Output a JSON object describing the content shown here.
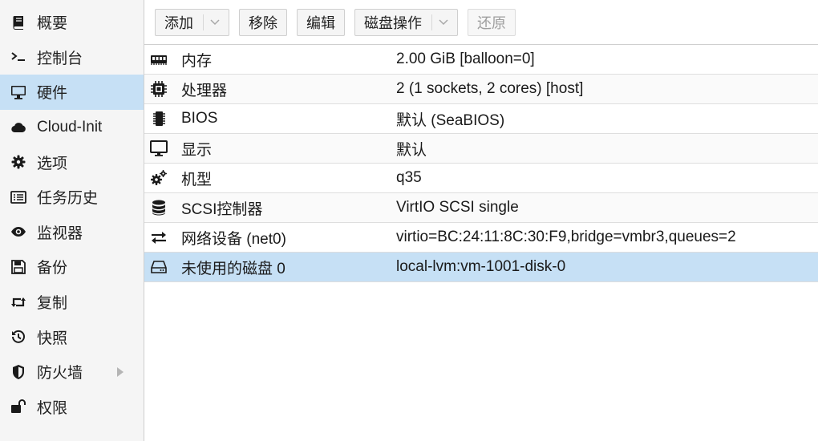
{
  "sidebar": {
    "items": [
      {
        "label": "概要",
        "icon": "book-icon"
      },
      {
        "label": "控制台",
        "icon": "terminal-icon"
      },
      {
        "label": "硬件",
        "icon": "monitor-icon"
      },
      {
        "label": "Cloud-Init",
        "icon": "cloud-icon"
      },
      {
        "label": "选项",
        "icon": "gear-icon"
      },
      {
        "label": "任务历史",
        "icon": "list-icon"
      },
      {
        "label": "监视器",
        "icon": "eye-icon"
      },
      {
        "label": "备份",
        "icon": "save-icon"
      },
      {
        "label": "复制",
        "icon": "retweet-icon"
      },
      {
        "label": "快照",
        "icon": "history-icon"
      },
      {
        "label": "防火墙",
        "icon": "shield-icon"
      },
      {
        "label": "权限",
        "icon": "unlock-icon"
      }
    ],
    "active_index": 2
  },
  "toolbar": {
    "add_label": "添加",
    "remove_label": "移除",
    "edit_label": "编辑",
    "disk_action_label": "磁盘操作",
    "revert_label": "还原"
  },
  "hardware": {
    "rows": [
      {
        "key": "内存",
        "value": "2.00 GiB [balloon=0]",
        "icon": "memory-icon"
      },
      {
        "key": "处理器",
        "value": "2 (1 sockets, 2 cores) [host]",
        "icon": "cpu-icon"
      },
      {
        "key": "BIOS",
        "value": "默认 (SeaBIOS)",
        "icon": "microchip-icon"
      },
      {
        "key": "显示",
        "value": "默认",
        "icon": "desktop-icon"
      },
      {
        "key": "机型",
        "value": "q35",
        "icon": "cogs-icon"
      },
      {
        "key": "SCSI控制器",
        "value": "VirtIO SCSI single",
        "icon": "database-icon"
      },
      {
        "key": "网络设备 (net0)",
        "value": "virtio=BC:24:11:8C:30:F9,bridge=vmbr3,queues=2",
        "icon": "exchange-icon"
      },
      {
        "key": "未使用的磁盘 0",
        "value": "local-lvm:vm-1001-disk-0",
        "icon": "hdd-icon"
      }
    ],
    "selected_index": 7
  },
  "colors": {
    "selection": "#c6e0f5",
    "sidebar_bg": "#f5f5f5"
  }
}
